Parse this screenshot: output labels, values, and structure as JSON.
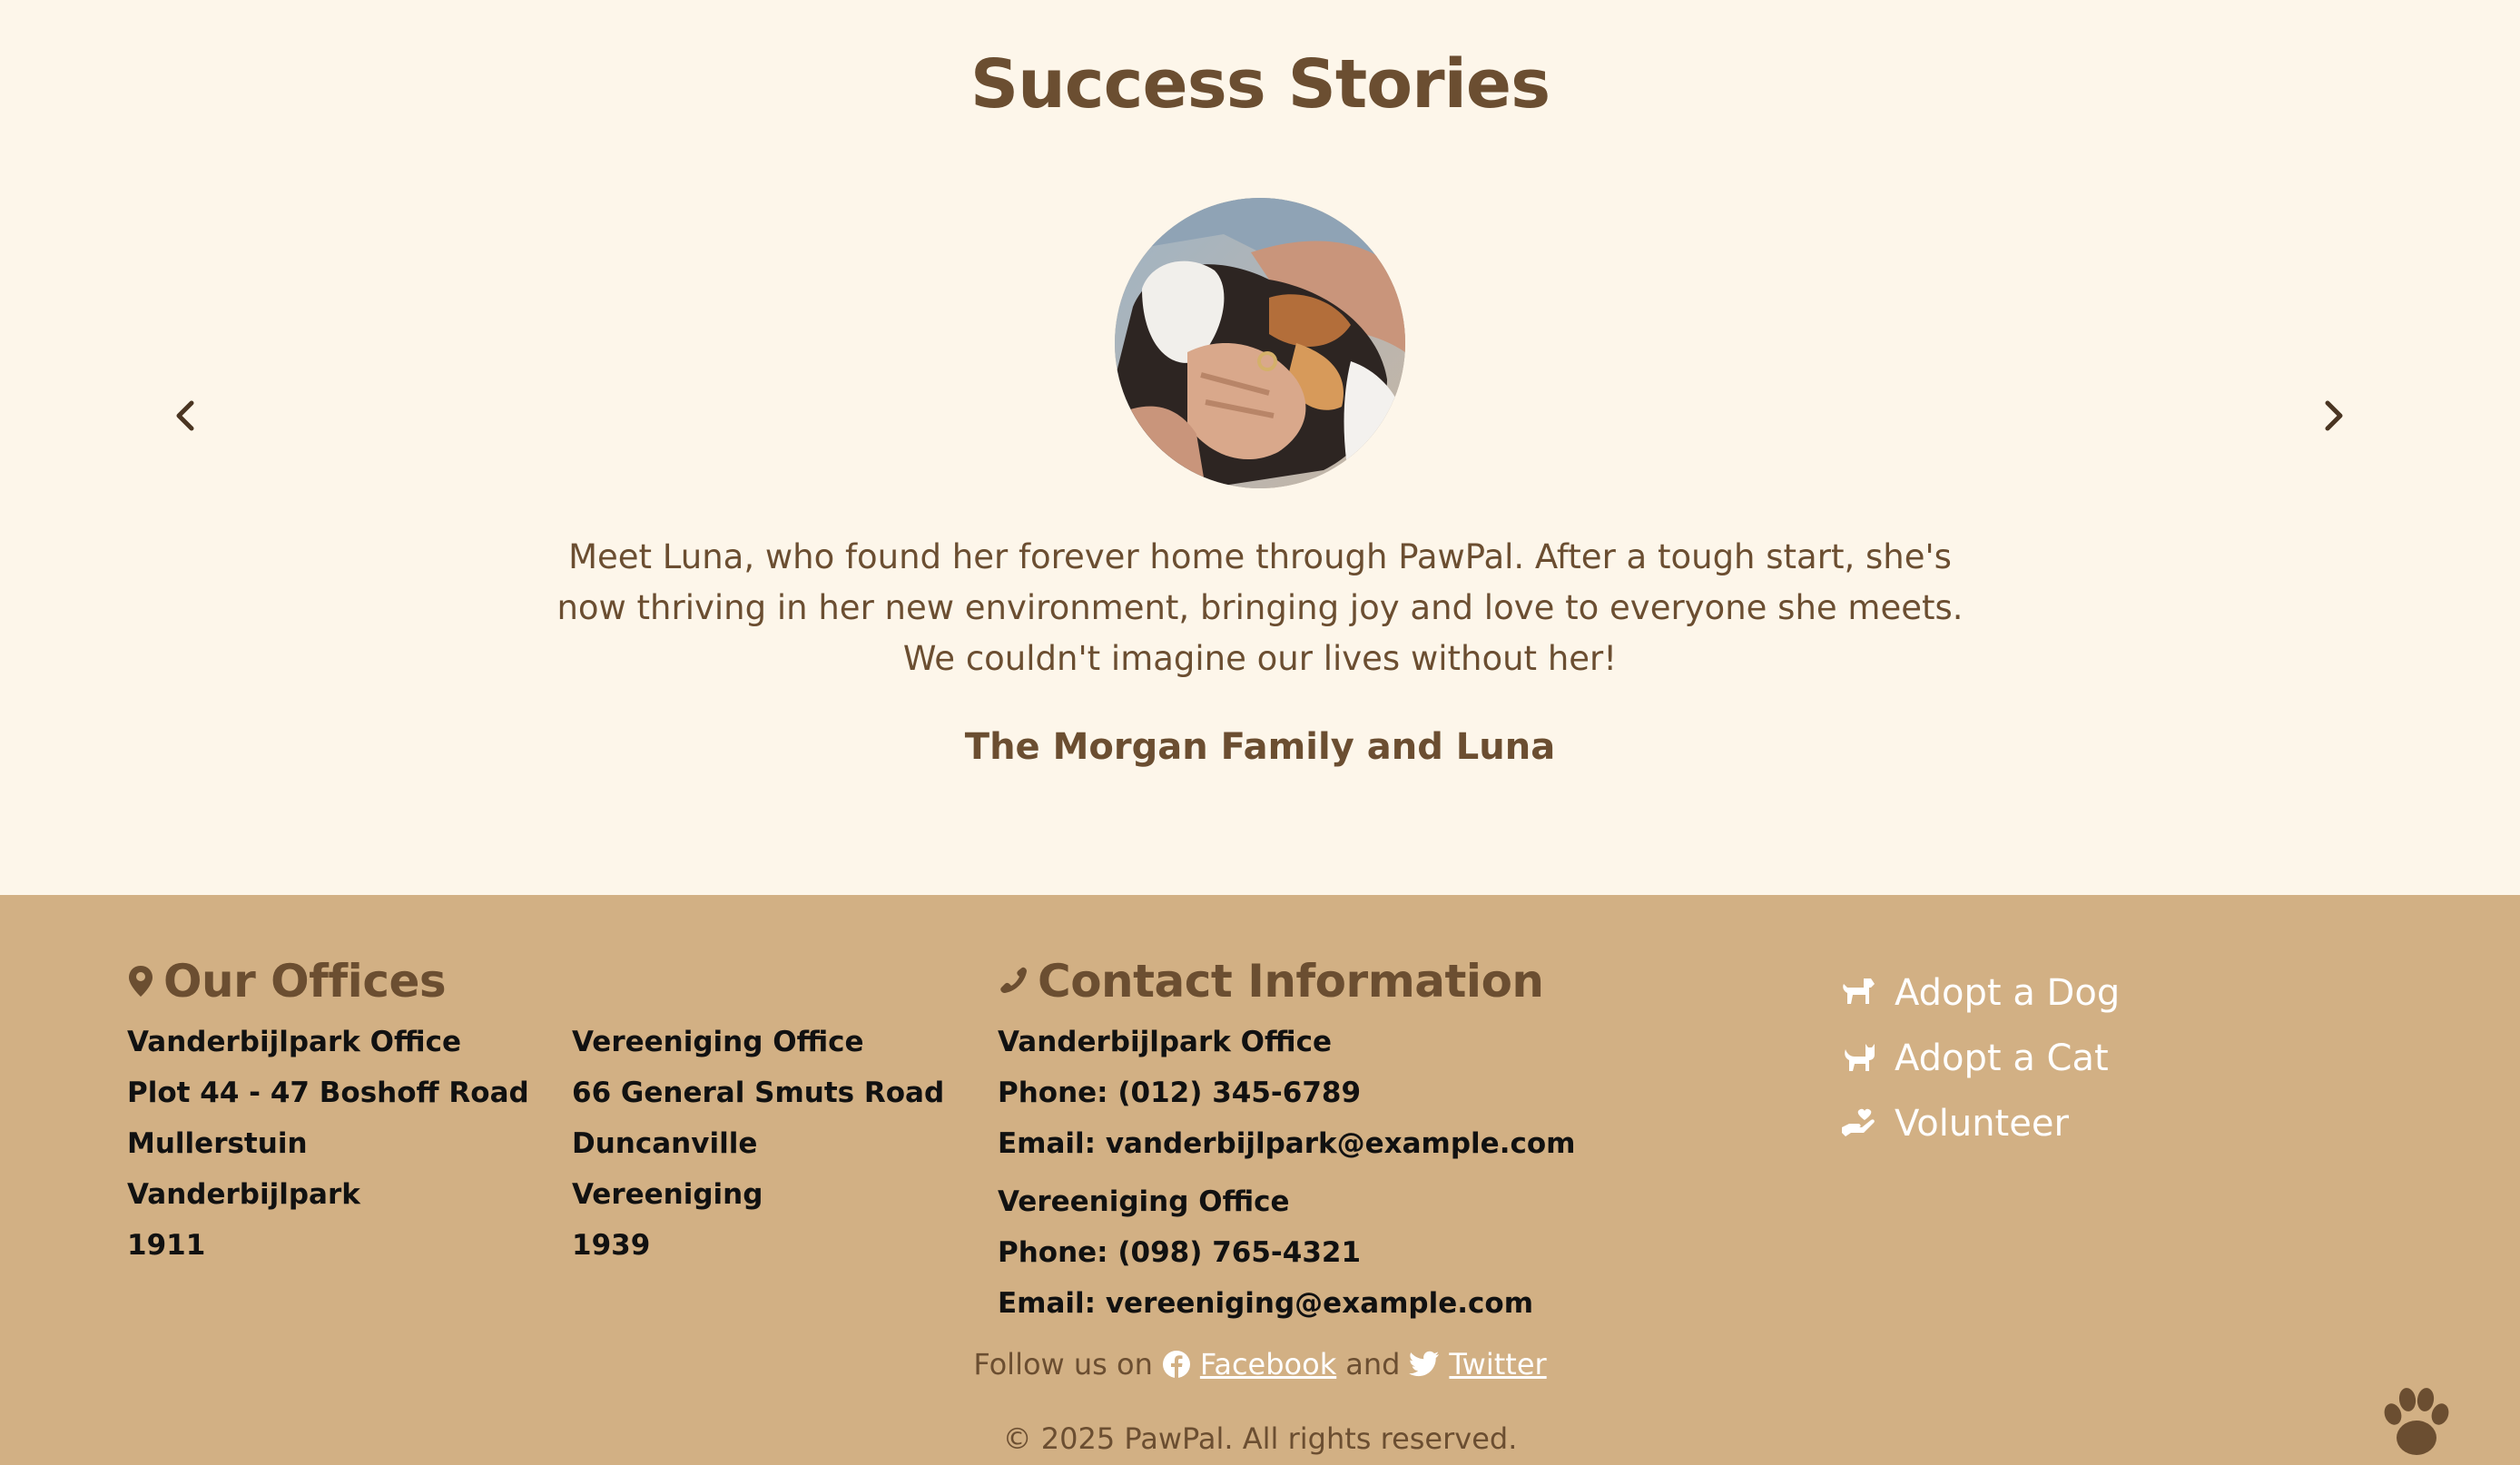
{
  "stories": {
    "title": "Success Stories",
    "photo_subject": "cat-with-owner-photo",
    "text": "Meet Luna, who found her forever home through PawPal. After a tough start, she's now thriving in her new environment, bringing joy and love to everyone she meets. We couldn't imagine our lives without her!",
    "author": "The Morgan Family and Luna",
    "prev_icon": "chevron-left-icon",
    "next_icon": "chevron-right-icon"
  },
  "footer": {
    "offices": {
      "title": "Our Offices",
      "icon": "map-pin-icon",
      "vanderbijlpark": [
        "Vanderbijlpark Office",
        "Plot 44 - 47 Boshoff Road",
        "Mullerstuin",
        "Vanderbijlpark",
        "1911"
      ],
      "vereeniging": [
        "Vereeniging Office",
        "66 General Smuts Road",
        "Duncanville",
        "Vereeniging",
        "1939"
      ]
    },
    "contact": {
      "title": "Contact Information",
      "icon": "phone-icon",
      "vanderbijlpark": [
        "Vanderbijlpark Office",
        "Phone: (012) 345-6789",
        "Email: vanderbijlpark@example.com"
      ],
      "vereeniging": [
        "Vereeniging Office",
        "Phone: (098) 765-4321",
        "Email: vereeniging@example.com"
      ]
    },
    "links": [
      {
        "label": "Adopt a Dog",
        "icon": "dog-icon"
      },
      {
        "label": "Adopt a Cat",
        "icon": "cat-icon"
      },
      {
        "label": "Volunteer",
        "icon": "helping-hand-icon"
      }
    ],
    "follow": {
      "prefix": "Follow us on",
      "facebook": "Facebook",
      "conjunction": "and",
      "twitter": "Twitter"
    },
    "copyright": "© 2025 PawPal. All rights reserved.",
    "paw_icon": "paw-icon"
  },
  "colors": {
    "page_bg": "#fdf6ea",
    "footer_bg": "#d2b084",
    "brown": "#6b4e31",
    "white": "#ffffff"
  }
}
